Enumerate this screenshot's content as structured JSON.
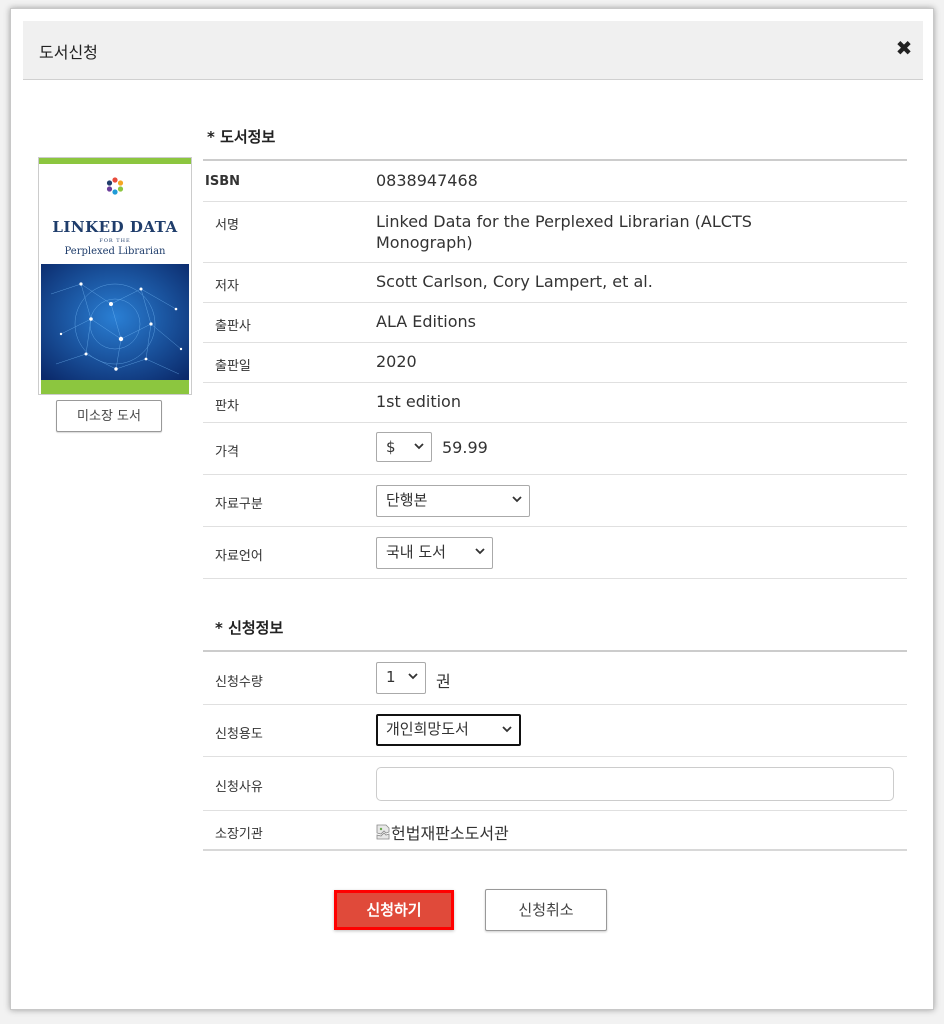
{
  "modal": {
    "title": "도서신청",
    "close_icon": "close-icon"
  },
  "book": {
    "cover": {
      "title_line1": "LINKED DATA",
      "for_the": "FOR THE",
      "subtitle": "Perplexed Librarian"
    },
    "not_owned_label": "미소장 도서"
  },
  "book_info": {
    "section_title": "* 도서정보",
    "isbn_label": "ISBN",
    "isbn": "0838947468",
    "title_label": "서명",
    "title_line1": "Linked Data for the Perplexed Librarian (ALCTS",
    "title_line2": "Monograph)",
    "author_label": "저자",
    "author": "Scott Carlson, Cory Lampert, et al.",
    "publisher_label": "출판사",
    "publisher": "ALA Editions",
    "pub_date_label": "출판일",
    "pub_date": "2020",
    "edition_label": "판차",
    "edition": "1st edition",
    "price_label": "가격",
    "currency": "$",
    "price": "59.99",
    "material_type_label": "자료구분",
    "material_type": "단행본",
    "language_label": "자료언어",
    "language": "국내 도서"
  },
  "request_info": {
    "section_title": "* 신청정보",
    "quantity_label": "신청수량",
    "quantity": "1",
    "quantity_unit": "권",
    "purpose_label": "신청용도",
    "purpose": "개인희망도서",
    "reason_label": "신청사유",
    "reason_value": "",
    "holding_label": "소장기관",
    "holding": "헌법재판소도서관"
  },
  "actions": {
    "submit_label": "신청하기",
    "cancel_label": "신청취소"
  },
  "colors": {
    "submit_bg": "#e04a3a",
    "submit_border": "#ff0000",
    "cover_accent": "#8cc63f",
    "cover_title": "#1f3d6b"
  }
}
